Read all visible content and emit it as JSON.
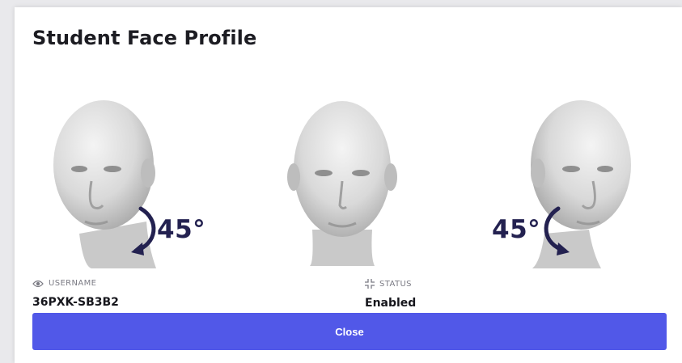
{
  "modal": {
    "title": "Student Face Profile"
  },
  "faces": [
    {
      "view": "turned-left",
      "angle_label": "45°",
      "icon": "face-left-icon"
    },
    {
      "view": "front",
      "angle_label": "",
      "icon": "face-front-icon"
    },
    {
      "view": "turned-right",
      "angle_label": "45°",
      "icon": "face-right-icon"
    }
  ],
  "fields": {
    "username": {
      "label": "USERNAME",
      "value": "36PXK-SB3B2",
      "icon": "eye-icon"
    },
    "status": {
      "label": "STATUS",
      "value": "Enabled",
      "icon": "compress-icon"
    }
  },
  "actions": {
    "close_label": "Close"
  },
  "colors": {
    "accent": "#5158e8",
    "arrow": "#232150",
    "title": "#1c1c22",
    "muted": "#7b7b84"
  }
}
